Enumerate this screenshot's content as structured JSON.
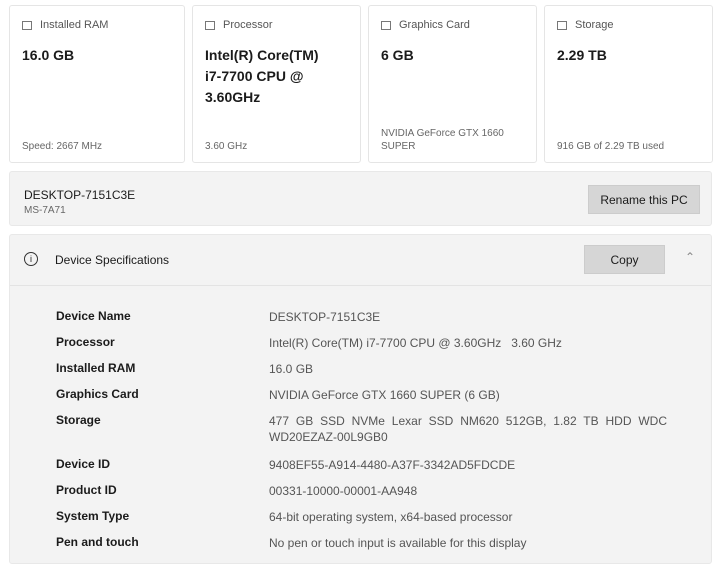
{
  "cards": [
    {
      "icon": "ram-icon",
      "label": "Installed RAM",
      "value": "16.0 GB",
      "sub": "Speed: 2667 MHz"
    },
    {
      "icon": "processor-icon",
      "label": "Processor",
      "value": "Intel(R) Core(TM) i7-7700 CPU @ 3.60GHz",
      "sub": "3.60 GHz"
    },
    {
      "icon": "graphics-card-icon",
      "label": "Graphics Card",
      "value": "6 GB",
      "sub": "NVIDIA GeForce GTX 1660 SUPER"
    },
    {
      "icon": "storage-icon",
      "label": "Storage",
      "value": "2.29 TB",
      "sub": "916 GB of 2.29 TB used"
    }
  ],
  "pc": {
    "name": "DESKTOP-7151C3E",
    "model": "MS-7A71",
    "rename": "Rename this PC"
  },
  "specs": {
    "title": "Device Specifications",
    "copy": "Copy",
    "rows": [
      {
        "k": "Device Name",
        "v": "DESKTOP-7151C3E"
      },
      {
        "k": "Processor",
        "v": "Intel(R) Core(TM) i7-7700 CPU @ 3.60GHz   3.60 GHz"
      },
      {
        "k": "Installed RAM",
        "v": "16.0 GB"
      },
      {
        "k": "Graphics Card",
        "v": "NVIDIA GeForce GTX 1660 SUPER (6 GB)"
      },
      {
        "k": "Storage",
        "v": "477 GB SSD NVMe Lexar SSD NM620 512GB, 1.82 TB HDD WDC WD20EZAZ-00L9GB0"
      },
      {
        "k": "Device ID",
        "v": "9408EF55-A914-4480-A37F-3342AD5FDCDE"
      },
      {
        "k": "Product ID",
        "v": "00331-10000-00001-AA948"
      },
      {
        "k": "System Type",
        "v": "64-bit operating system, x64-based processor"
      },
      {
        "k": "Pen and touch",
        "v": "No pen or touch input is available for this display"
      }
    ]
  }
}
